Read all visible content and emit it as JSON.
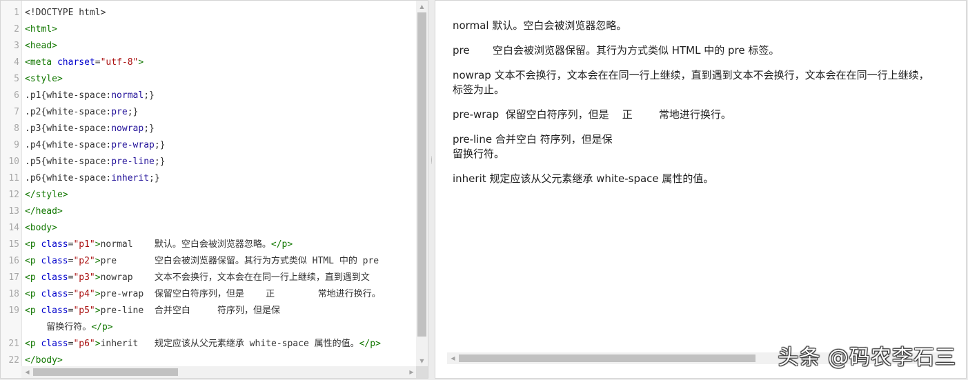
{
  "editor": {
    "lines": [
      {
        "n": "1",
        "parts": [
          {
            "c": "plain",
            "t": "<!DOCTYPE html>"
          }
        ]
      },
      {
        "n": "2",
        "parts": [
          {
            "c": "tag",
            "t": "<html>"
          }
        ]
      },
      {
        "n": "3",
        "parts": [
          {
            "c": "tag",
            "t": "<head>"
          }
        ]
      },
      {
        "n": "4",
        "parts": [
          {
            "c": "tag",
            "t": "<meta "
          },
          {
            "c": "attr",
            "t": "charset"
          },
          {
            "c": "plain",
            "t": "="
          },
          {
            "c": "str",
            "t": "\"utf-8\""
          },
          {
            "c": "tag",
            "t": ">"
          }
        ]
      },
      {
        "n": "5",
        "parts": [
          {
            "c": "tag",
            "t": "<style>"
          }
        ]
      },
      {
        "n": "6",
        "parts": [
          {
            "c": "plain",
            "t": ".p1{white-space:"
          },
          {
            "c": "cssval",
            "t": "normal"
          },
          {
            "c": "plain",
            "t": ";}"
          }
        ]
      },
      {
        "n": "7",
        "parts": [
          {
            "c": "plain",
            "t": ".p2{white-space:"
          },
          {
            "c": "cssval",
            "t": "pre"
          },
          {
            "c": "plain",
            "t": ";}"
          }
        ]
      },
      {
        "n": "8",
        "parts": [
          {
            "c": "plain",
            "t": ".p3{white-space:"
          },
          {
            "c": "cssval",
            "t": "nowrap"
          },
          {
            "c": "plain",
            "t": ";}"
          }
        ]
      },
      {
        "n": "9",
        "parts": [
          {
            "c": "plain",
            "t": ".p4{white-space:"
          },
          {
            "c": "cssval",
            "t": "pre-wrap"
          },
          {
            "c": "plain",
            "t": ";}"
          }
        ]
      },
      {
        "n": "10",
        "parts": [
          {
            "c": "plain",
            "t": ".p5{white-space:"
          },
          {
            "c": "cssval",
            "t": "pre-line"
          },
          {
            "c": "plain",
            "t": ";}"
          }
        ]
      },
      {
        "n": "11",
        "parts": [
          {
            "c": "plain",
            "t": ".p6{white-space:"
          },
          {
            "c": "cssval",
            "t": "inherit"
          },
          {
            "c": "plain",
            "t": ";}"
          }
        ]
      },
      {
        "n": "12",
        "parts": [
          {
            "c": "tag",
            "t": "</style>"
          }
        ]
      },
      {
        "n": "13",
        "parts": [
          {
            "c": "tag",
            "t": "</head>"
          }
        ]
      },
      {
        "n": "14",
        "parts": [
          {
            "c": "tag",
            "t": "<body>"
          }
        ]
      },
      {
        "n": "15",
        "parts": [
          {
            "c": "tag",
            "t": "<p "
          },
          {
            "c": "attr",
            "t": "class"
          },
          {
            "c": "plain",
            "t": "="
          },
          {
            "c": "str",
            "t": "\"p1\""
          },
          {
            "c": "tag",
            "t": ">"
          },
          {
            "c": "plain",
            "t": "normal    默认。空白会被浏览器忽略。"
          },
          {
            "c": "tag",
            "t": "</p>"
          }
        ]
      },
      {
        "n": "16",
        "parts": [
          {
            "c": "tag",
            "t": "<p "
          },
          {
            "c": "attr",
            "t": "class"
          },
          {
            "c": "plain",
            "t": "="
          },
          {
            "c": "str",
            "t": "\"p2\""
          },
          {
            "c": "tag",
            "t": ">"
          },
          {
            "c": "plain",
            "t": "pre       空白会被浏览器保留。其行为方式类似 HTML 中的 pre"
          }
        ]
      },
      {
        "n": "17",
        "parts": [
          {
            "c": "tag",
            "t": "<p "
          },
          {
            "c": "attr",
            "t": "class"
          },
          {
            "c": "plain",
            "t": "="
          },
          {
            "c": "str",
            "t": "\"p3\""
          },
          {
            "c": "tag",
            "t": ">"
          },
          {
            "c": "plain",
            "t": "nowrap    文本不会换行，文本会在在同一行上继续，直到遇到文"
          }
        ]
      },
      {
        "n": "18",
        "parts": [
          {
            "c": "tag",
            "t": "<p "
          },
          {
            "c": "attr",
            "t": "class"
          },
          {
            "c": "plain",
            "t": "="
          },
          {
            "c": "str",
            "t": "\"p4\""
          },
          {
            "c": "tag",
            "t": ">"
          },
          {
            "c": "plain",
            "t": "pre-wrap  保留空白符序列，但是    正        常地进行换行。"
          }
        ]
      },
      {
        "n": "19",
        "parts": [
          {
            "c": "tag",
            "t": "<p "
          },
          {
            "c": "attr",
            "t": "class"
          },
          {
            "c": "plain",
            "t": "="
          },
          {
            "c": "str",
            "t": "\"p5\""
          },
          {
            "c": "tag",
            "t": ">"
          },
          {
            "c": "plain",
            "t": "pre-line  合并空白     符序列，但是保"
          }
        ]
      },
      {
        "n": "",
        "parts": [
          {
            "c": "plain",
            "t": "    留换行符。"
          },
          {
            "c": "tag",
            "t": "</p>"
          }
        ]
      },
      {
        "n": "21",
        "parts": [
          {
            "c": "tag",
            "t": "<p "
          },
          {
            "c": "attr",
            "t": "class"
          },
          {
            "c": "plain",
            "t": "="
          },
          {
            "c": "str",
            "t": "\"p6\""
          },
          {
            "c": "tag",
            "t": ">"
          },
          {
            "c": "plain",
            "t": "inherit   规定应该从父元素继承 white-space 属性的值。"
          },
          {
            "c": "tag",
            "t": "</p>"
          }
        ]
      },
      {
        "n": "22",
        "parts": [
          {
            "c": "tag",
            "t": "</body>"
          }
        ]
      }
    ],
    "colors": {
      "tag": "#117700",
      "attr": "#0000cc",
      "string": "#aa1111",
      "css_value": "#221199"
    }
  },
  "preview": {
    "p1": "normal    默认。空白会被浏览器忽略。",
    "p2": "pre       空白会被浏览器保留。其行为方式类似 HTML 中的 pre 标签。",
    "p3": "nowrap    文本不会换行，文本会在在同一行上继续，直到遇到文本不会换行，文本会在在同一行上继续，",
    "p3_line2": "标签为止。",
    "p4": "pre-wrap  保留空白符序列，但是    正        常地进行换行。",
    "p5": "pre-line  合并空白     符序列，但是保\n留换行符。",
    "p6": "inherit   规定应该从父元素继承 white-space 属性的值。"
  },
  "icons": {
    "scroll_up": "triangle-up-icon",
    "scroll_down": "triangle-down-icon",
    "scroll_left": "triangle-left-icon",
    "scroll_right": "triangle-right-icon",
    "splitter_grip": "grip-dots-icon"
  },
  "watermark": "头条 @码农李石三"
}
